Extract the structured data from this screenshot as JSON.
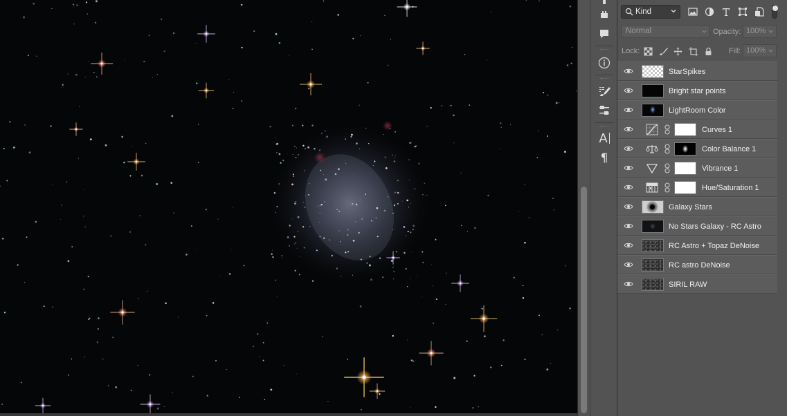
{
  "layers_panel": {
    "filter": {
      "kind_label": "Kind",
      "icons": [
        "image-filter-icon",
        "adjustment-filter-icon",
        "type-filter-icon",
        "shape-filter-icon",
        "smart-object-filter-icon"
      ]
    },
    "blend_mode": "Normal",
    "opacity_label": "Opacity:",
    "opacity_value": "100%",
    "lock_label": "Lock:",
    "fill_label": "Fill:",
    "fill_value": "100%",
    "layers": [
      {
        "name": "StarSpikes",
        "thumb": "checker",
        "type": "pixel"
      },
      {
        "name": "Bright star points",
        "thumb": "black",
        "type": "pixel"
      },
      {
        "name": "LightRoom Color",
        "thumb": "lightroom",
        "type": "pixel"
      },
      {
        "name": "Curves 1",
        "icon": "curves-icon",
        "type": "adjustment",
        "mask": "white"
      },
      {
        "name": "Color Balance 1",
        "icon": "color-balance-icon",
        "type": "adjustment",
        "mask": "galaxy"
      },
      {
        "name": "Vibrance 1",
        "icon": "vibrance-icon",
        "type": "adjustment",
        "mask": "white"
      },
      {
        "name": "Hue/Saturation 1",
        "icon": "hue-saturation-icon",
        "type": "adjustment",
        "mask": "white"
      },
      {
        "name": "Galaxy Stars",
        "thumb": "galaxy-stars",
        "type": "pixel"
      },
      {
        "name": "No Stars Galaxy - RC Astro",
        "thumb": "dark-galaxy",
        "type": "pixel"
      },
      {
        "name": "RC Astro + Topaz DeNoise",
        "thumb": "noise",
        "type": "pixel"
      },
      {
        "name": "RC astro DeNoise",
        "thumb": "noise",
        "type": "pixel"
      },
      {
        "name": "SIRIL RAW",
        "thumb": "noise",
        "type": "pixel"
      }
    ]
  },
  "toolstrip": {
    "text_tool_glyph": "A",
    "paragraph_glyph": "¶"
  }
}
